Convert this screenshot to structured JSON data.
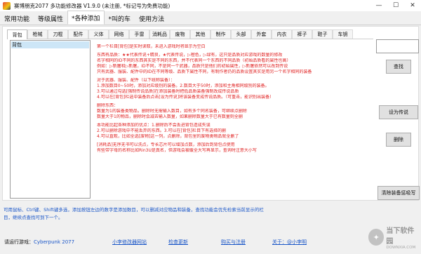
{
  "window": {
    "title": "赛博朋克2077 多功能修改器 V1.9.0 (未注册, *标记号为免费功能)",
    "minimize": "—",
    "maximize": "☐",
    "close": "✕"
  },
  "main_tabs": [
    "常用功能",
    "等级属性",
    "*各种添加",
    "*叫的车",
    "使用方法"
  ],
  "category_tabs": [
    "背包",
    "枪械",
    "刀棍",
    "配件",
    "义体",
    "网络",
    "手雷",
    "消耗品",
    "废物",
    "其他",
    "制作",
    "头部",
    "外套",
    "内衣",
    "裤子",
    "鞋子",
    "车钥"
  ],
  "item_list": {
    "selected": "背包"
  },
  "help_lines": [
    "第一个栏目[背包]是实时读取，未进入游戏时将显示为空白",
    "",
    "东西有品质：★★代表传说+精良，★代表传说，▷橙色，▷绿有，这只是品质对应游戏的数量的修改",
    "名字相同的ID不同的东西其实是不同的东西，并不代表同一个东西的不同品质（初始品质看的属性也高）",
    "例如：▷新屠和▷新屠，ID不同，不是同一个武器，品质只是他们的初始属性，▷新屠依然可以改到传说",
    "只有武器、服装、配件中的ID在不同等级、品质下属性不同，有制作者仍的品质设置其实是用另一个名字相同的装备",
    "",
    "对于武器、服装、配件（以下统称装备）：",
    "1.添加数目0~50时，添加对应级别的装备。2.数目大于50时，添加和主角相同级别的装备。",
    "3.可以通过勾选[强制传说品质]在添加装备时把低品质装备强制改成传说品质",
    "4.可以在[背包]栏选中装备后点击[设为传说]将该装备变成传说品质。（可重击，能识别出装备）",
    "",
    "删除东西：",
    "数量为1的装备类物品，删除时无需输入数目，如有多个同名装备，可继续点删除",
    "数量大于1的物品，删除时会减去输入数量，如果删除数量大于已有数量则全删",
    "",
    "本功能比起各种添加的优点：1.删除后不会丢进背包造成失误",
    "2.可以删除游戏中不能丢弃的东西。3.可以在[背包]栏目下有选择的删",
    "4.可以直观，比如全选[废物]这一列，点删除，背包里的废物类物品就全删了",
    "",
    "[消耗品]无序无书可以洗点，专长芯片可以增加点数，添加后到背包点使用",
    "有些带字母的名称比如Rin3U是真名，但游戏会被缓全大写再显示，查询时注意大小写"
  ],
  "search": {
    "value": "",
    "button": "查找"
  },
  "buttons": {
    "set_legend": "设为传说",
    "delete": "删除",
    "clear_memory": "清除装备惩吸写"
  },
  "footer_tips": [
    "可用鼠标、Ctrl键、Shift键多选，添加按钮左边的数字是添加数目，可以删减对应物品和装备，查找功能会优先检索当前显示的栏",
    "目，继续点查找可到下一个。"
  ],
  "status": {
    "game_label": "请运行游戏：",
    "game_name": "Cyberpunk 2077",
    "links": [
      "小李修改器网站",
      "检查更新",
      "购买与注册",
      "关于：@小李明"
    ]
  },
  "watermark": {
    "name": "当下软件园",
    "sub": "DOWNXIA.COM",
    "logo": "✦"
  },
  "colors": {
    "help_text": "#e02020",
    "link": "#1a56c8",
    "selection": "#cde6f7"
  }
}
